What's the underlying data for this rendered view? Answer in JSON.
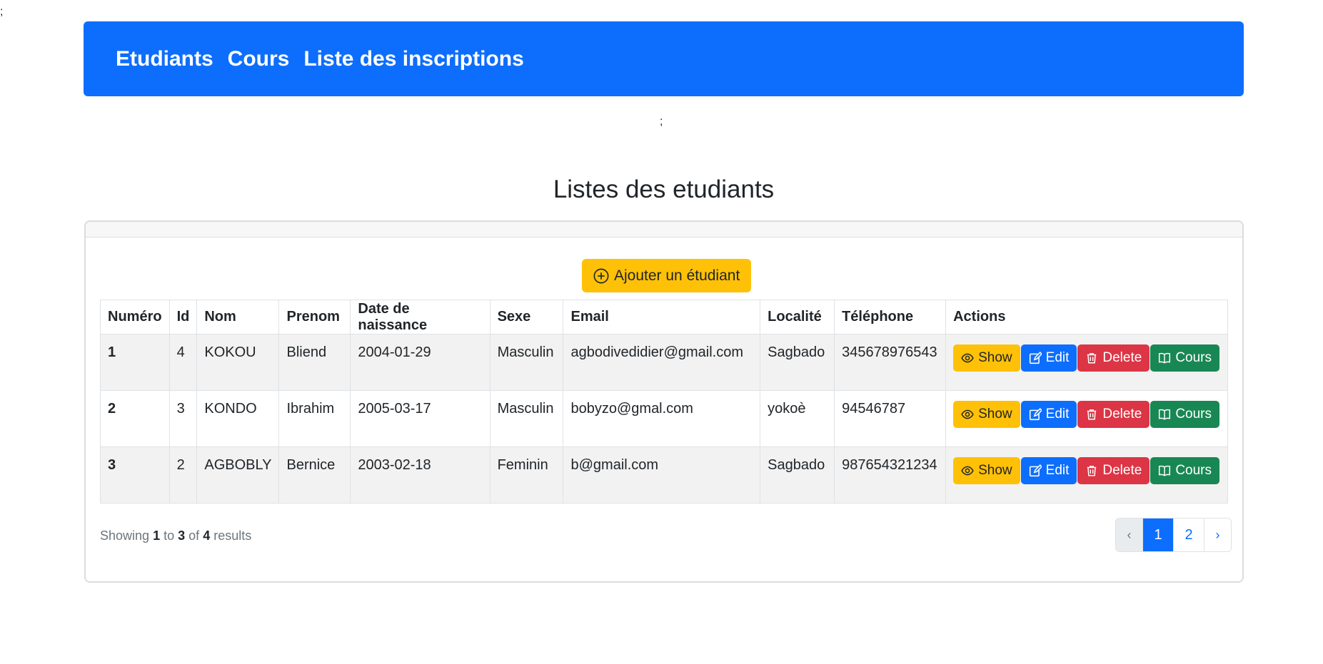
{
  "stray_text_top": ";",
  "stray_text_mid": ";",
  "nav": {
    "items": [
      "Etudiants",
      "Cours",
      "Liste des inscriptions"
    ]
  },
  "page_title": "Listes des etudiants",
  "add_button_label": "Ajouter un étudiant",
  "table": {
    "headers": [
      "Numéro",
      "Id",
      "Nom",
      "Prenom",
      "Date de naissance",
      "Sexe",
      "Email",
      "Localité",
      "Téléphone",
      "Actions"
    ],
    "rows": [
      {
        "numero": "1",
        "id": "4",
        "nom": "KOKOU",
        "prenom": "Bliend",
        "date": "2004-01-29",
        "sexe": "Masculin",
        "email": "agbodivedidier@gmail.com",
        "localite": "Sagbado",
        "telephone": "345678976543"
      },
      {
        "numero": "2",
        "id": "3",
        "nom": "KONDO",
        "prenom": "Ibrahim",
        "date": "2005-03-17",
        "sexe": "Masculin",
        "email": "bobyzo@gmal.com",
        "localite": "yokoè",
        "telephone": "94546787"
      },
      {
        "numero": "3",
        "id": "2",
        "nom": "AGBOBLY",
        "prenom": "Bernice",
        "date": "2003-02-18",
        "sexe": "Feminin",
        "email": "b@gmail.com",
        "localite": "Sagbado",
        "telephone": "987654321234"
      }
    ],
    "actions": {
      "show": "Show",
      "edit": "Edit",
      "delete": "Delete",
      "cours": "Cours"
    }
  },
  "pagination": {
    "showing_prefix": "Showing",
    "from": "1",
    "to_word": "to",
    "to": "3",
    "of_word": "of",
    "total": "4",
    "results_word": "results",
    "prev": "‹",
    "pages": [
      "1",
      "2"
    ],
    "next": "›",
    "current_page": "1"
  },
  "colors": {
    "primary": "#0d6efd",
    "warning": "#ffc107",
    "danger": "#dc3545",
    "success": "#198754"
  }
}
